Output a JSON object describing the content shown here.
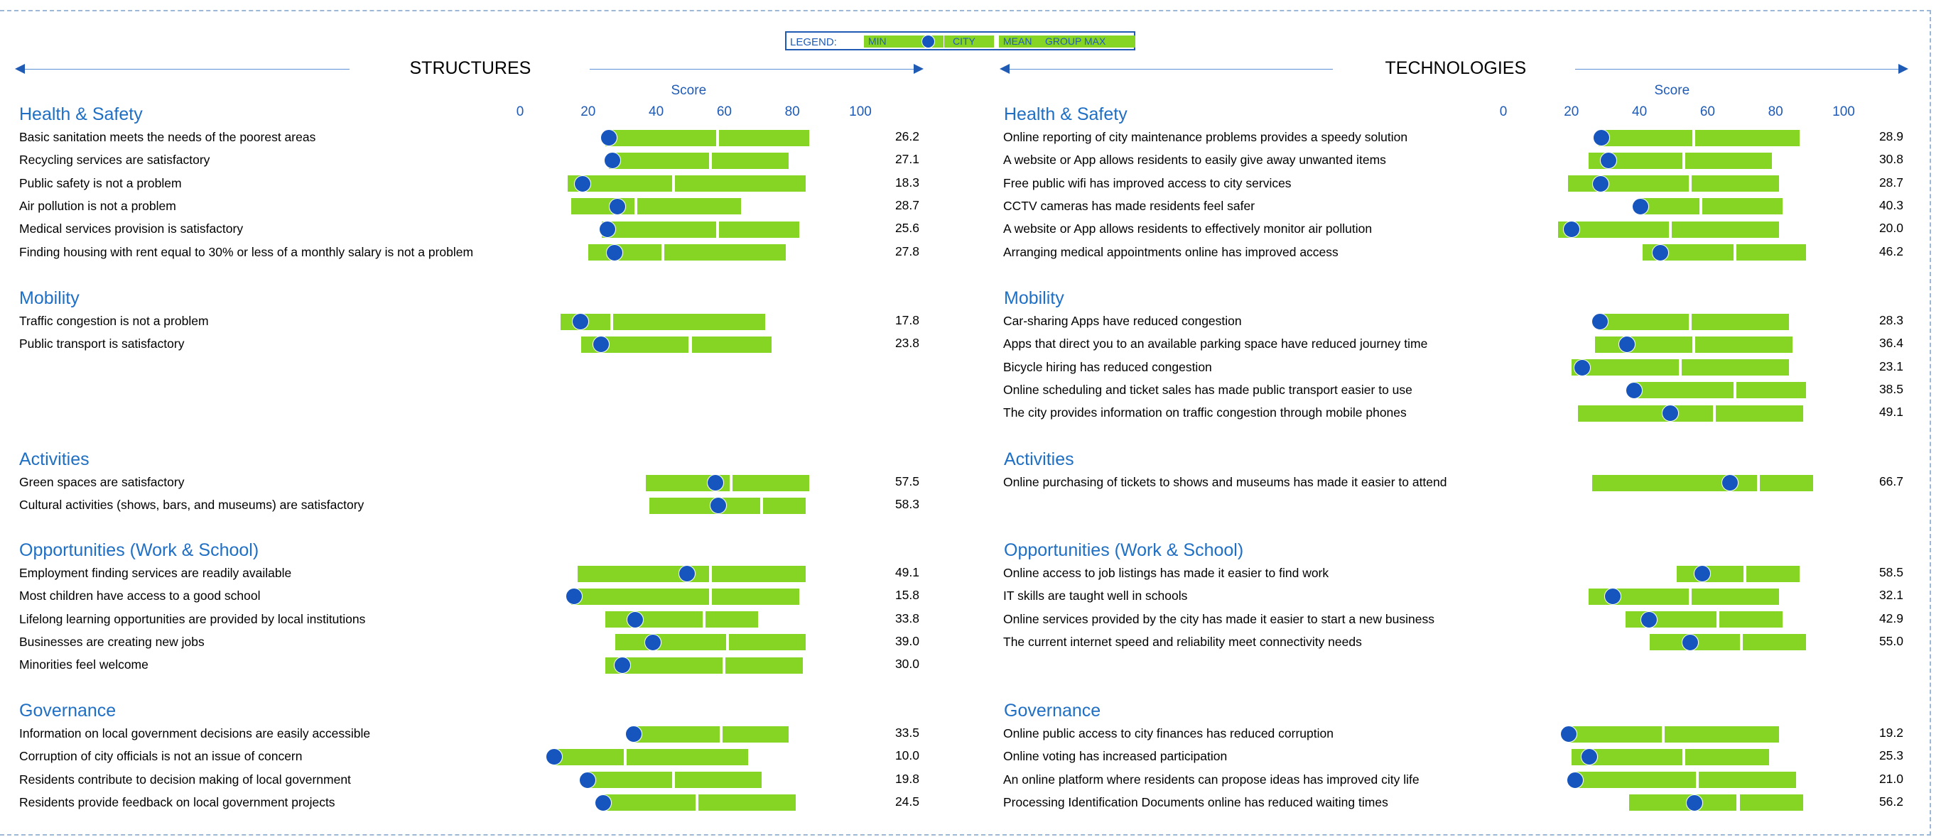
{
  "legend": {
    "label": "LEGEND:",
    "min": "MIN",
    "city": "CITY",
    "mean": "MEAN",
    "max": "GROUP MAX"
  },
  "colors": {
    "bar": "#86d525",
    "dot": "#1655bd",
    "accent": "#1f6fc5"
  },
  "chart_data": [
    {
      "type": "range-dot",
      "title": "STRUCTURES",
      "xlabel": "Score",
      "ticks": [
        0,
        20,
        40,
        60,
        80,
        100
      ],
      "xlim": [
        0,
        100
      ],
      "categories": [
        {
          "name": "Health & Safety",
          "items": [
            {
              "label": "Basic sanitation meets the needs of the poorest areas",
              "min": 25,
              "mean": 58,
              "max": 85,
              "city": 26.2,
              "value_text": "26.2"
            },
            {
              "label": "Recycling services are satisfactory",
              "min": 26,
              "mean": 56,
              "max": 79,
              "city": 27.1,
              "value_text": "27.1"
            },
            {
              "label": "Public safety is not a problem",
              "min": 14,
              "mean": 45,
              "max": 84,
              "city": 18.3,
              "value_text": "18.3"
            },
            {
              "label": "Air pollution is not a problem",
              "min": 15,
              "mean": 34,
              "max": 65,
              "city": 28.7,
              "value_text": "28.7"
            },
            {
              "label": "Medical services provision is satisfactory",
              "min": 24,
              "mean": 58,
              "max": 82,
              "city": 25.6,
              "value_text": "25.6"
            },
            {
              "label": "Finding housing with rent equal to 30% or less of a monthly salary is not a problem",
              "min": 20,
              "mean": 42,
              "max": 78,
              "city": 27.8,
              "value_text": "27.8"
            }
          ]
        },
        {
          "name": "Mobility",
          "items": [
            {
              "label": "Traffic congestion is not a problem",
              "min": 12,
              "mean": 27,
              "max": 72,
              "city": 17.8,
              "value_text": "17.8"
            },
            {
              "label": "Public transport is satisfactory",
              "min": 18,
              "mean": 50,
              "max": 74,
              "city": 23.8,
              "value_text": "23.8"
            }
          ]
        },
        {
          "name": "Activities",
          "items": [
            {
              "label": "Green spaces are satisfactory",
              "min": 37,
              "mean": 62,
              "max": 85,
              "city": 57.5,
              "value_text": "57.5"
            },
            {
              "label": "Cultural activities (shows, bars, and museums) are satisfactory",
              "min": 38,
              "mean": 71,
              "max": 84,
              "city": 58.3,
              "value_text": "58.3"
            }
          ]
        },
        {
          "name": "Opportunities (Work & School)",
          "items": [
            {
              "label": "Employment finding services are readily available",
              "min": 17,
              "mean": 56,
              "max": 84,
              "city": 49.1,
              "value_text": "49.1"
            },
            {
              "label": "Most children have access to a good school",
              "min": 15,
              "mean": 56,
              "max": 82,
              "city": 15.8,
              "value_text": "15.8"
            },
            {
              "label": "Lifelong learning opportunities are provided by local institutions",
              "min": 25,
              "mean": 54,
              "max": 70,
              "city": 33.8,
              "value_text": "33.8"
            },
            {
              "label": "Businesses are creating new jobs",
              "min": 28,
              "mean": 61,
              "max": 84,
              "city": 39.0,
              "value_text": "39.0"
            },
            {
              "label": "Minorities feel welcome",
              "min": 25,
              "mean": 60,
              "max": 83,
              "city": 30.0,
              "value_text": "30.0"
            }
          ]
        },
        {
          "name": "Governance",
          "items": [
            {
              "label": "Information on local government decisions are easily accessible",
              "min": 33,
              "mean": 59,
              "max": 79,
              "city": 33.5,
              "value_text": "33.5"
            },
            {
              "label": "Corruption of city officials is not an issue of concern",
              "min": 10,
              "mean": 31,
              "max": 67,
              "city": 10.0,
              "value_text": "10.0"
            },
            {
              "label": "Residents contribute to decision making of local government",
              "min": 20,
              "mean": 45,
              "max": 71,
              "city": 19.8,
              "value_text": "19.8"
            },
            {
              "label": "Residents provide feedback on local government projects",
              "min": 24,
              "mean": 52,
              "max": 81,
              "city": 24.5,
              "value_text": "24.5"
            }
          ]
        }
      ]
    },
    {
      "type": "range-dot",
      "title": "TECHNOLOGIES",
      "xlabel": "Score",
      "ticks": [
        0,
        20,
        40,
        60,
        80,
        100
      ],
      "xlim": [
        0,
        100
      ],
      "categories": [
        {
          "name": "Health & Safety",
          "items": [
            {
              "label": "Online reporting of city maintenance problems provides a speedy solution",
              "min": 28,
              "mean": 56,
              "max": 87,
              "city": 28.9,
              "value_text": "28.9"
            },
            {
              "label": "A website or App allows residents to easily give away unwanted items",
              "min": 25,
              "mean": 53,
              "max": 79,
              "city": 30.8,
              "value_text": "30.8"
            },
            {
              "label": "Free public wifi has improved access to city services",
              "min": 19,
              "mean": 55,
              "max": 81,
              "city": 28.7,
              "value_text": "28.7"
            },
            {
              "label": "CCTV cameras has made residents feel safer",
              "min": 40,
              "mean": 58,
              "max": 82,
              "city": 40.3,
              "value_text": "40.3"
            },
            {
              "label": "A website or App allows residents to effectively monitor air pollution",
              "min": 16,
              "mean": 49,
              "max": 81,
              "city": 20.0,
              "value_text": "20.0"
            },
            {
              "label": "Arranging medical appointments online has improved access",
              "min": 41,
              "mean": 68,
              "max": 89,
              "city": 46.2,
              "value_text": "46.2"
            }
          ]
        },
        {
          "name": "Mobility",
          "items": [
            {
              "label": "Car-sharing Apps have reduced congestion",
              "min": 28,
              "mean": 55,
              "max": 84,
              "city": 28.3,
              "value_text": "28.3"
            },
            {
              "label": "Apps that direct you to an available parking space have reduced journey time",
              "min": 27,
              "mean": 56,
              "max": 85,
              "city": 36.4,
              "value_text": "36.4"
            },
            {
              "label": "Bicycle hiring has reduced congestion",
              "min": 20,
              "mean": 52,
              "max": 84,
              "city": 23.1,
              "value_text": "23.1"
            },
            {
              "label": "Online scheduling and ticket sales has made public transport easier to use",
              "min": 38,
              "mean": 68,
              "max": 89,
              "city": 38.5,
              "value_text": "38.5"
            },
            {
              "label": "The city provides information on traffic congestion through mobile phones",
              "min": 22,
              "mean": 62,
              "max": 88,
              "city": 49.1,
              "value_text": "49.1"
            }
          ]
        },
        {
          "name": "Activities",
          "items": [
            {
              "label": "Online purchasing of tickets to shows and museums has made it easier to attend",
              "min": 26,
              "mean": 75,
              "max": 91,
              "city": 66.7,
              "value_text": "66.7"
            }
          ]
        },
        {
          "name": "Opportunities (Work & School)",
          "items": [
            {
              "label": "Online access to job listings has made it easier to find work",
              "min": 51,
              "mean": 71,
              "max": 87,
              "city": 58.5,
              "value_text": "58.5"
            },
            {
              "label": "IT skills are taught well in schools",
              "min": 25,
              "mean": 55,
              "max": 81,
              "city": 32.1,
              "value_text": "32.1"
            },
            {
              "label": "Online services provided by the city has made it easier to start a new business",
              "min": 36,
              "mean": 63,
              "max": 82,
              "city": 42.9,
              "value_text": "42.9"
            },
            {
              "label": "The current internet speed and reliability meet connectivity needs",
              "min": 43,
              "mean": 70,
              "max": 89,
              "city": 55.0,
              "value_text": "55.0"
            }
          ]
        },
        {
          "name": "Governance",
          "items": [
            {
              "label": "Online public access to city finances has reduced corruption",
              "min": 19,
              "mean": 47,
              "max": 81,
              "city": 19.2,
              "value_text": "19.2"
            },
            {
              "label": "Online voting has increased participation",
              "min": 20,
              "mean": 53,
              "max": 78,
              "city": 25.3,
              "value_text": "25.3"
            },
            {
              "label": "An online platform where residents can propose ideas has improved city life",
              "min": 21,
              "mean": 57,
              "max": 86,
              "city": 21.0,
              "value_text": "21.0"
            },
            {
              "label": "Processing Identification Documents online has reduced waiting times",
              "min": 37,
              "mean": 69,
              "max": 88,
              "city": 56.2,
              "value_text": "56.2"
            }
          ]
        }
      ]
    }
  ]
}
